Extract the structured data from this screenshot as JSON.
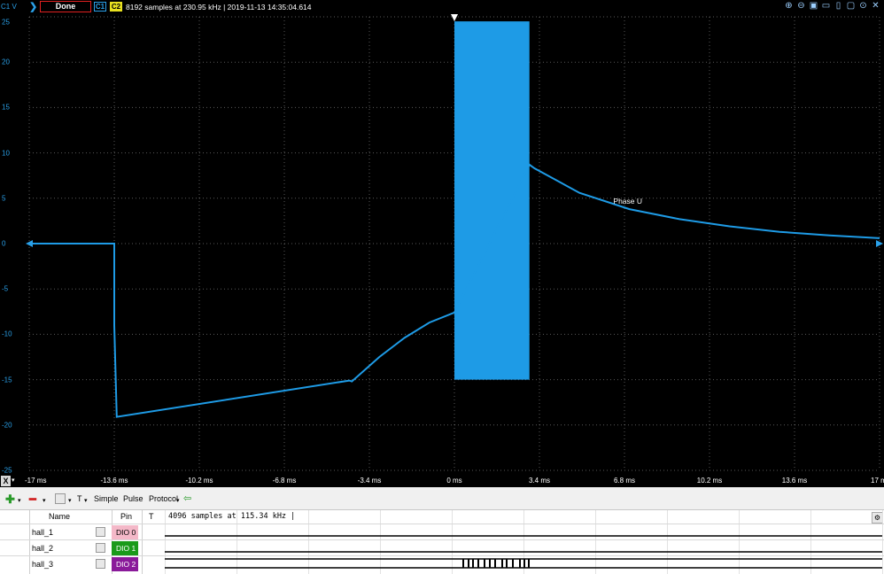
{
  "top": {
    "channel_unit": "C1 V",
    "status": "Done",
    "ch1": "C1",
    "ch2": "C2",
    "info": "8192 samples at 230.95 kHz | 2019-11-13 14:35:04.614",
    "icons": [
      "zoom-in-icon",
      "zoom-out-icon",
      "zoom-fit-icon",
      "zoom-horizontal-icon",
      "zoom-vertical-icon",
      "zoom-window-icon",
      "help-icon",
      "close-icon"
    ]
  },
  "yaxis": {
    "labels": [
      "25",
      "20",
      "15",
      "10",
      "5",
      "0",
      "-5",
      "-10",
      "-15",
      "-20",
      "-25"
    ]
  },
  "xaxis": {
    "button": "X",
    "labels": [
      "-17 ms",
      "-13.6 ms",
      "-10.2 ms",
      "-6.8 ms",
      "-3.4 ms",
      "0 ms",
      "3.4 ms",
      "6.8 ms",
      "10.2 ms",
      "13.6 ms",
      "17 ms"
    ]
  },
  "trace": {
    "label": "Phase U",
    "color": "#1e9be6"
  },
  "toolbar": {
    "simple": "Simple",
    "pulse": "Pulse",
    "protocol": "Protocol",
    "t": "T"
  },
  "digital": {
    "headers": {
      "name": "Name",
      "pin": "Pin",
      "t": "T"
    },
    "info": "4096 samples at 115.34 kHz |",
    "rows": [
      {
        "name": "hall_1",
        "pin": "DIO 0",
        "pin_bg": "#f4b8c8",
        "pin_fg": "#000000"
      },
      {
        "name": "hall_2",
        "pin": "DIO 1",
        "pin_bg": "#1a9a1a",
        "pin_fg": "#ffffff"
      },
      {
        "name": "hall_3",
        "pin": "DIO 2",
        "pin_bg": "#8a1a9a",
        "pin_fg": "#ffffff"
      }
    ]
  },
  "chart_data": {
    "type": "line",
    "xlim": [
      -17,
      17
    ],
    "ylim": [
      -25,
      25
    ],
    "grid": true,
    "series": [
      {
        "name": "Phase U",
        "x": [
          -17,
          -13.6,
          -13.6,
          -13.5,
          -4.2,
          -4.1,
          -3,
          -2,
          -1,
          0,
          3,
          3.2,
          5,
          7,
          9,
          11,
          13,
          15,
          17
        ],
        "y": [
          0,
          0,
          -9,
          -19.1,
          -15.1,
          -15.2,
          -12.5,
          -10.4,
          -8.7,
          -7.6,
          8.7,
          8.3,
          5.6,
          3.8,
          2.7,
          1.9,
          1.3,
          0.9,
          0.6
        ]
      }
    ],
    "band": {
      "x_start": 0,
      "x_end": 3,
      "y_low": -15,
      "y_high": 24.5
    }
  }
}
